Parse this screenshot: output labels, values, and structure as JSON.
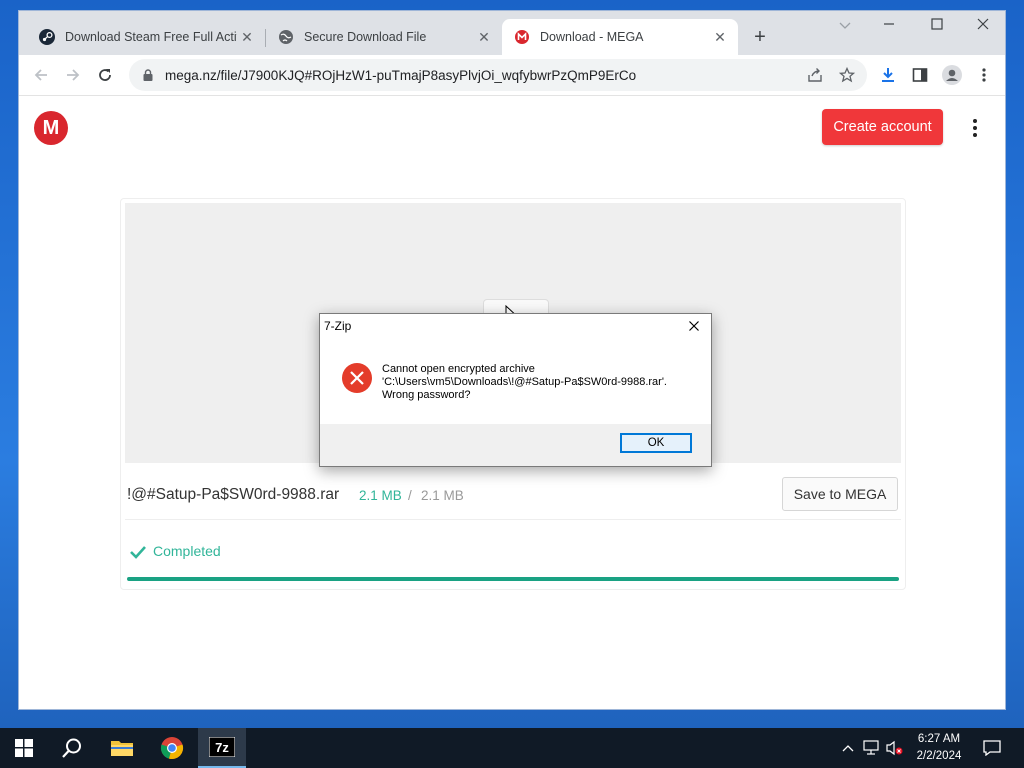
{
  "browser": {
    "tabs": [
      {
        "title": "Download Steam Free Full Activa",
        "icon": "steam-icon",
        "active": false
      },
      {
        "title": "Secure Download File",
        "icon": "globe-icon",
        "active": false
      },
      {
        "title": "Download - MEGA",
        "icon": "mega-icon",
        "active": true
      }
    ],
    "url": "mega.nz/file/J7900KJQ#ROjHzW1-puTmajP8asyPlvjOi_wqfybwrPzQmP9ErCo",
    "new_tab_symbol": "+"
  },
  "mega": {
    "logo_letter": "M",
    "create_account": "Create account",
    "file": {
      "name": "!@#Satup-Pa$SW0rd-9988.rar",
      "downloaded": "2.1 MB",
      "separator": "/",
      "total": "2.1 MB",
      "save_label": "Save to MEGA",
      "status": "Completed",
      "progress": 1.0
    },
    "colors": {
      "brand": "#d9272e",
      "button": "#f0373a",
      "success": "#31b599",
      "progress": "#1aa283"
    }
  },
  "dialog": {
    "title": "7-Zip",
    "message_line1": "Cannot open encrypted archive",
    "message_line2": "'C:\\Users\\vm5\\Downloads\\!@#Satup-Pa$SW0rd-9988.rar'.",
    "message_line3": "Wrong password?",
    "ok_label": "OK",
    "icon": "error-icon"
  },
  "taskbar": {
    "items": [
      "start-icon",
      "search-icon",
      "file-explorer-icon",
      "chrome-icon",
      "7zip-icon"
    ],
    "app_7zip_label": "7z",
    "time": "6:27 AM",
    "date": "2/2/2024"
  }
}
